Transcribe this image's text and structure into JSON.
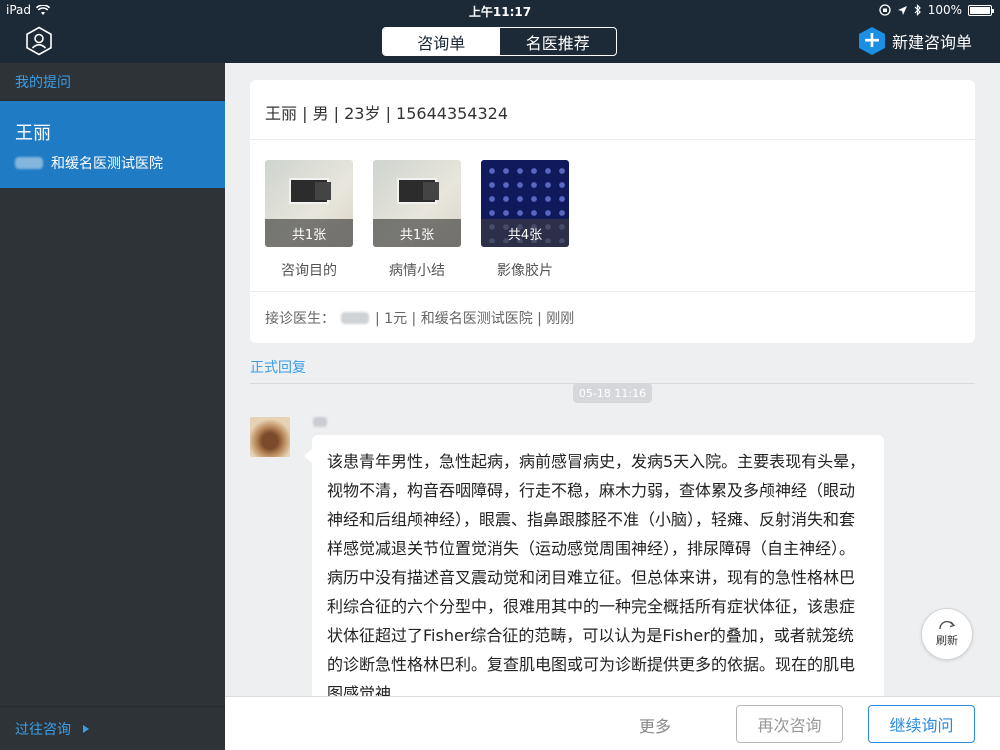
{
  "status_bar": {
    "device": "iPad",
    "time": "上午11:17",
    "battery": "100%",
    "battery_level": 1.0
  },
  "nav": {
    "tab_active": "咨询单",
    "tab_inactive": "名医推荐",
    "new_consult_label": "新建咨询单"
  },
  "sidebar": {
    "header": "我的提问",
    "item": {
      "name": "王丽",
      "hospital": "和缓名医测试医院"
    },
    "footer": "过往咨询"
  },
  "card": {
    "patient_info": "王丽 | 男 | 23岁 | 15644354324",
    "attachments": [
      {
        "count": "共1张",
        "label": "咨询目的"
      },
      {
        "count": "共1张",
        "label": "病情小结"
      },
      {
        "count": "共4张",
        "label": "影像胶片"
      }
    ],
    "doctor_prefix": "接诊医生：",
    "doctor_suffix": "| 1元 | 和缓名医测试医院 | 刚刚"
  },
  "reply": {
    "header": "正式回复",
    "timestamp": "05-18 11:16",
    "message": "该患青年男性，急性起病，病前感冒病史，发病5天入院。主要表现有头晕，视物不清，构音吞咽障碍，行走不稳，麻木力弱，查体累及多颅神经（眼动神经和后组颅神经），眼震、指鼻跟膝胫不准（小脑），轻瘫、反射消失和套样感觉减退关节位置觉消失（运动感觉周围神经），排尿障碍（自主神经）。病历中没有描述音叉震动觉和闭目难立征。但总体来讲，现有的急性格林巴利综合征的六个分型中，很难用其中的一种完全概括所有症状体征，该患症状体征超过了Fisher综合征的范畴，可以认为是Fisher的叠加，或者就笼统的诊断急性格林巴利。复查肌电图或可为诊断提供更多的依据。现在的肌电图感觉神"
  },
  "refresh_label": "刷新",
  "bottom": {
    "more": "更多",
    "again": "再次咨询",
    "continue": "继续询问"
  },
  "colors": {
    "nav_bg": "#1c2a38",
    "sidebar_bg": "#2e3338",
    "accent": "#1f7bc3",
    "link": "#3a9ee6"
  }
}
